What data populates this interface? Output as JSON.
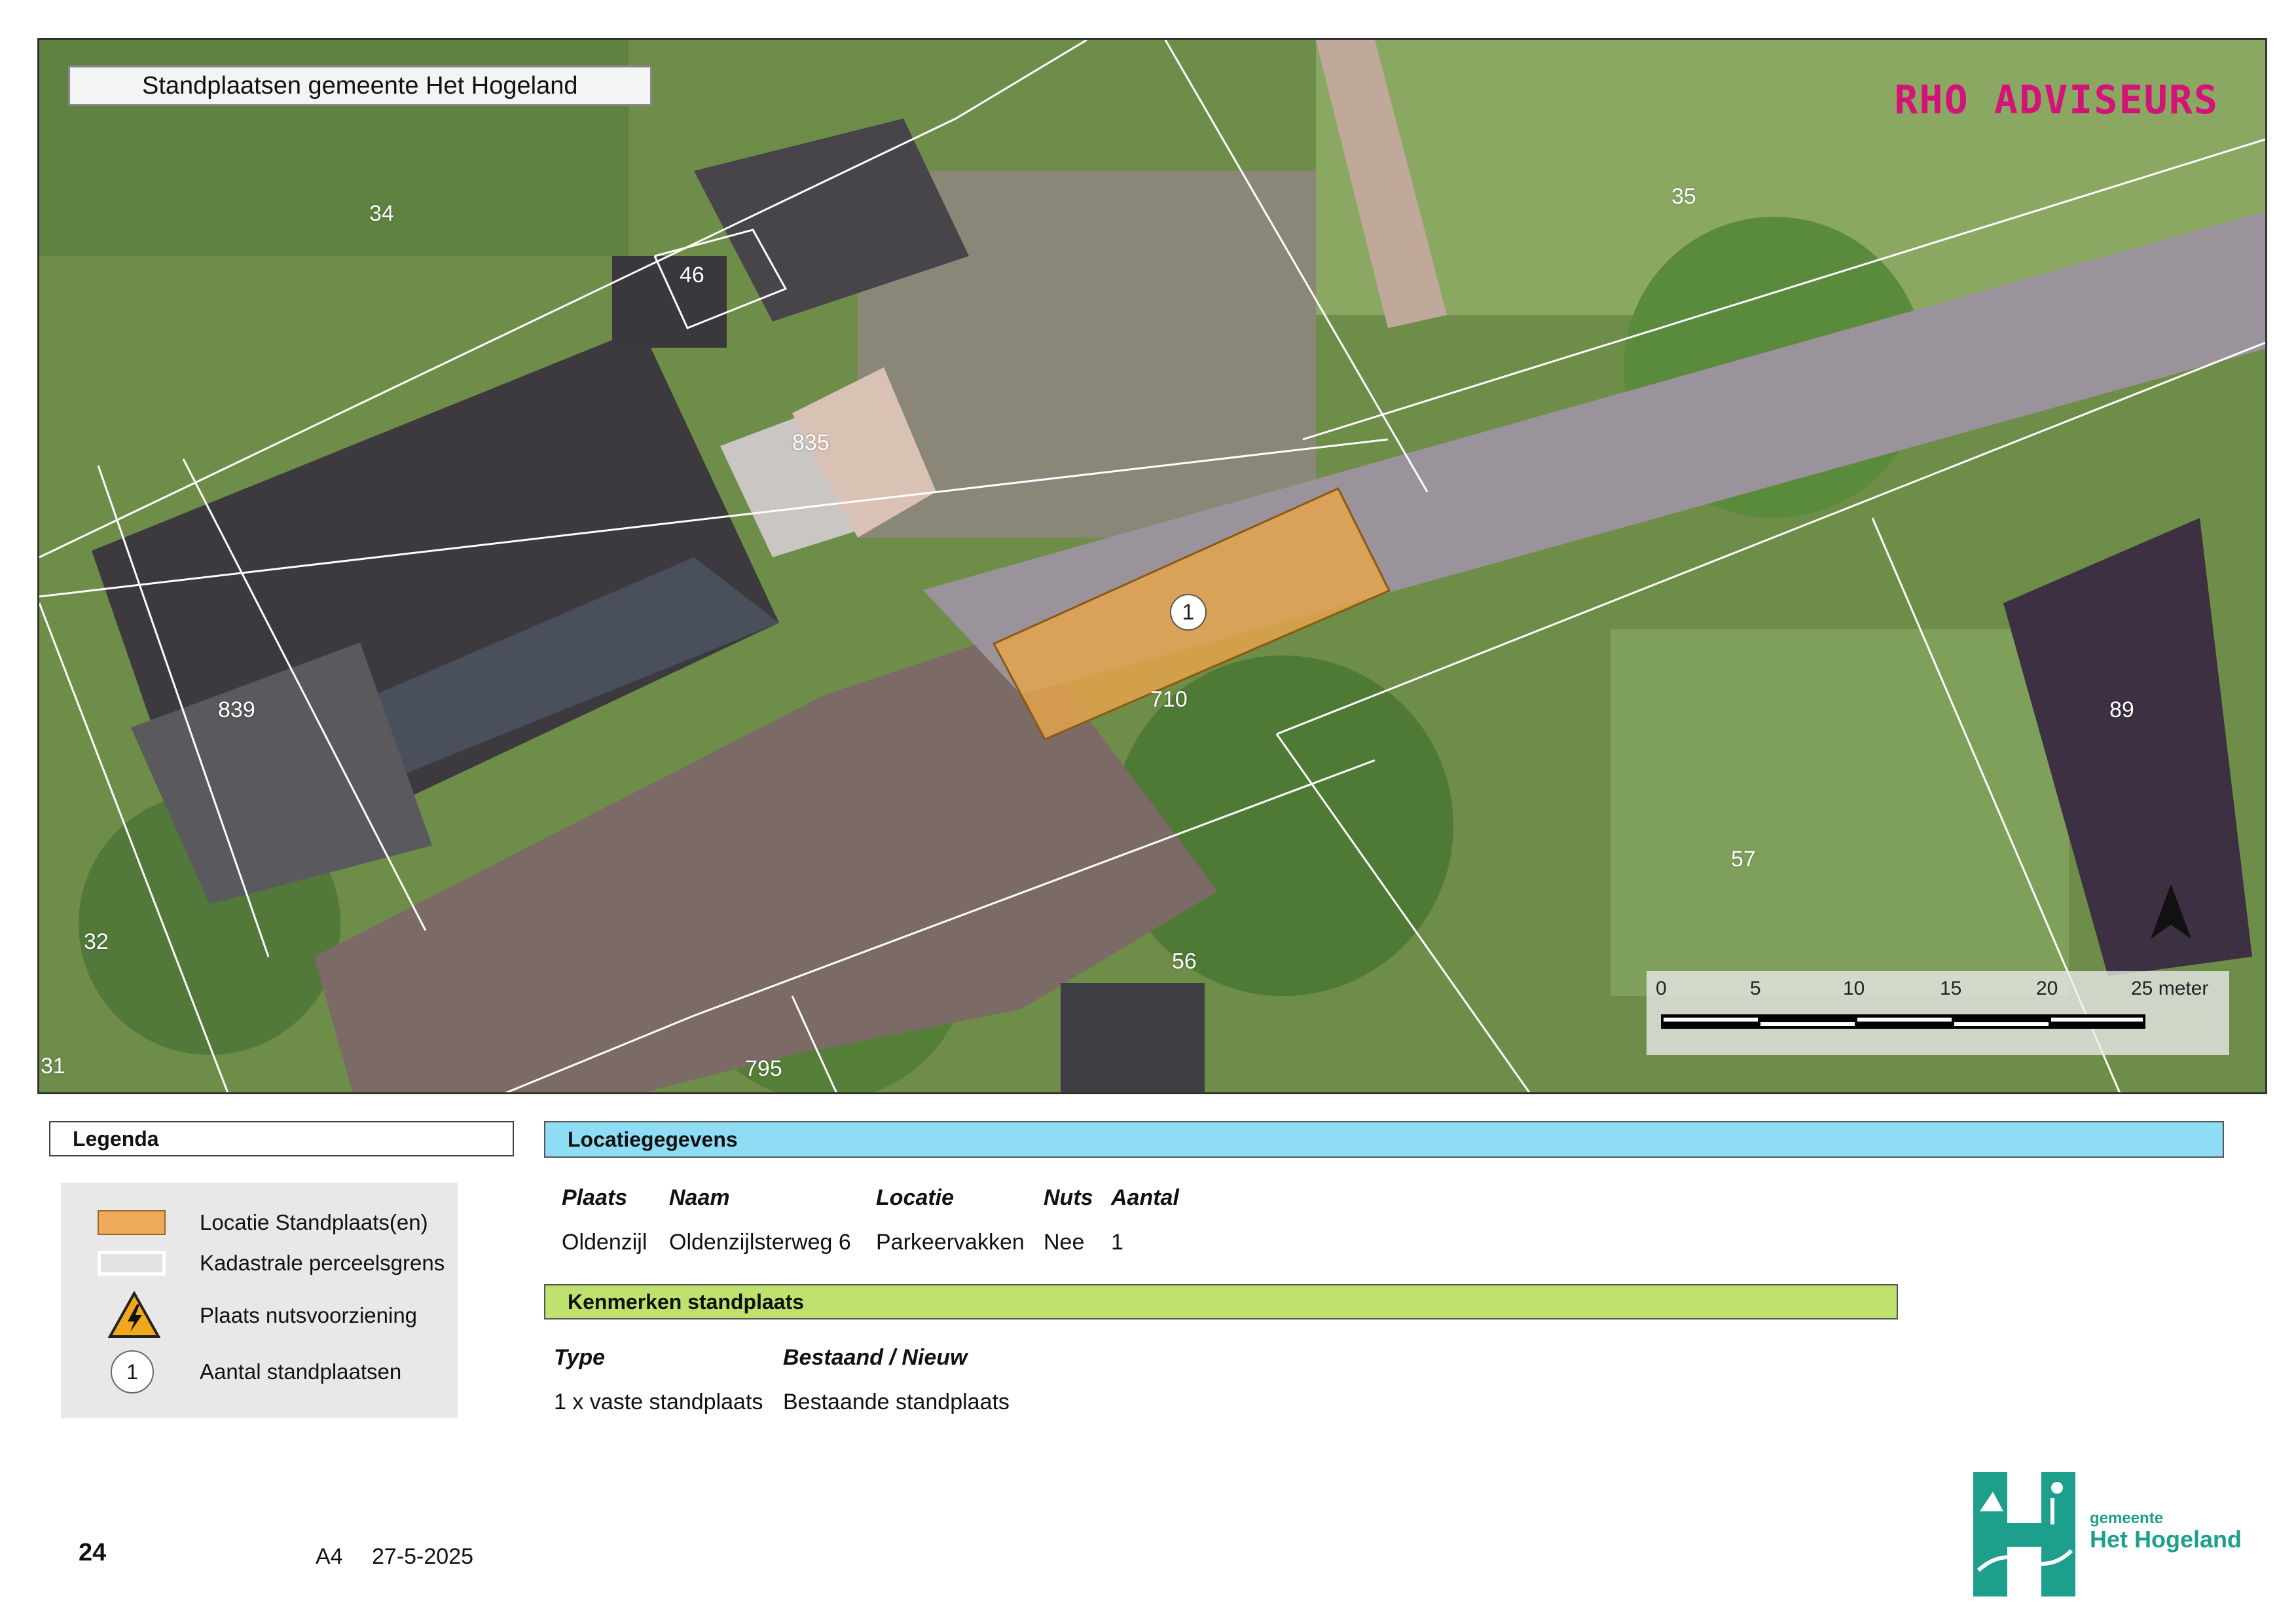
{
  "map": {
    "title": "Standplaatsen gemeente Het Hogeland",
    "brand": "RHO ADVISEURS",
    "parcels": [
      "34",
      "46",
      "835",
      "839",
      "35",
      "710",
      "89",
      "57",
      "32",
      "56",
      "31",
      "795"
    ],
    "marker_count": "1",
    "scale": {
      "ticks": [
        "0",
        "5",
        "10",
        "15",
        "20",
        "25 meter"
      ]
    },
    "colors": {
      "standplaats": "#e8a54b",
      "parcel_line": "#ffffff",
      "brand": "#d4137a"
    }
  },
  "legend": {
    "heading": "Legenda",
    "items": [
      {
        "icon": "orange-rect-icon",
        "label": "Locatie Standplaats(en)"
      },
      {
        "icon": "parcel-boundary-icon",
        "label": "Kadastrale perceelsgrens"
      },
      {
        "icon": "warning-electric-icon",
        "label": "Plaats nutsvoorziening"
      },
      {
        "icon": "count-circle-icon",
        "label": "Aantal standplaatsen",
        "marker": "1"
      }
    ]
  },
  "locatie": {
    "heading": "Locatiegegevens",
    "columns": [
      "Plaats",
      "Naam",
      "Locatie",
      "Nuts",
      "Aantal"
    ],
    "row": [
      "Oldenzijl",
      "Oldenzijlsterweg 6",
      "Parkeervakken",
      "Nee",
      "1"
    ]
  },
  "kenmerken": {
    "heading": "Kenmerken standplaats",
    "columns": [
      "Type",
      "Bestaand / Nieuw"
    ],
    "row": [
      "1 x vaste standplaats",
      "Bestaande standplaats"
    ]
  },
  "footer": {
    "page_number": "24",
    "paper_size": "A4",
    "date": "27-5-2025",
    "gemeente_small": "gemeente",
    "gemeente_name": "Het Hogeland"
  }
}
